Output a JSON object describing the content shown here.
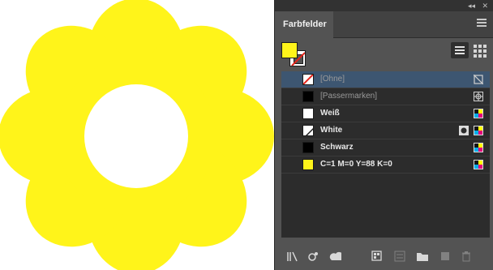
{
  "panel": {
    "title": "Farbfelder",
    "swatches": [
      {
        "name": "[Ohne]",
        "kind": "none",
        "selected": true,
        "dim": true,
        "right_icon": "no-edit-icon"
      },
      {
        "name": "[Passermarken]",
        "kind": "registration",
        "color": "#000000",
        "dim": true,
        "right_icon": "registration-icon"
      },
      {
        "name": "Weiß",
        "kind": "process",
        "color": "#ffffff",
        "bold": true,
        "right_icon": "cmyk-icon"
      },
      {
        "name": "White",
        "kind": "spot",
        "color": "#ffffff",
        "bold": true,
        "right_icon": "cmyk-icon",
        "extra_icon": "spot-icon"
      },
      {
        "name": "Schwarz",
        "kind": "process",
        "color": "#000000",
        "bold": true,
        "right_icon": "cmyk-icon"
      },
      {
        "name": "C=1 M=0 Y=88 K=0",
        "kind": "process",
        "color": "#fff41a",
        "bold": true,
        "right_icon": "cmyk-icon"
      }
    ]
  },
  "colors": {
    "flower": "#fff41a",
    "panel_bg": "#535353",
    "list_bg": "#2c2c2c",
    "selected_row": "#3d5671"
  }
}
